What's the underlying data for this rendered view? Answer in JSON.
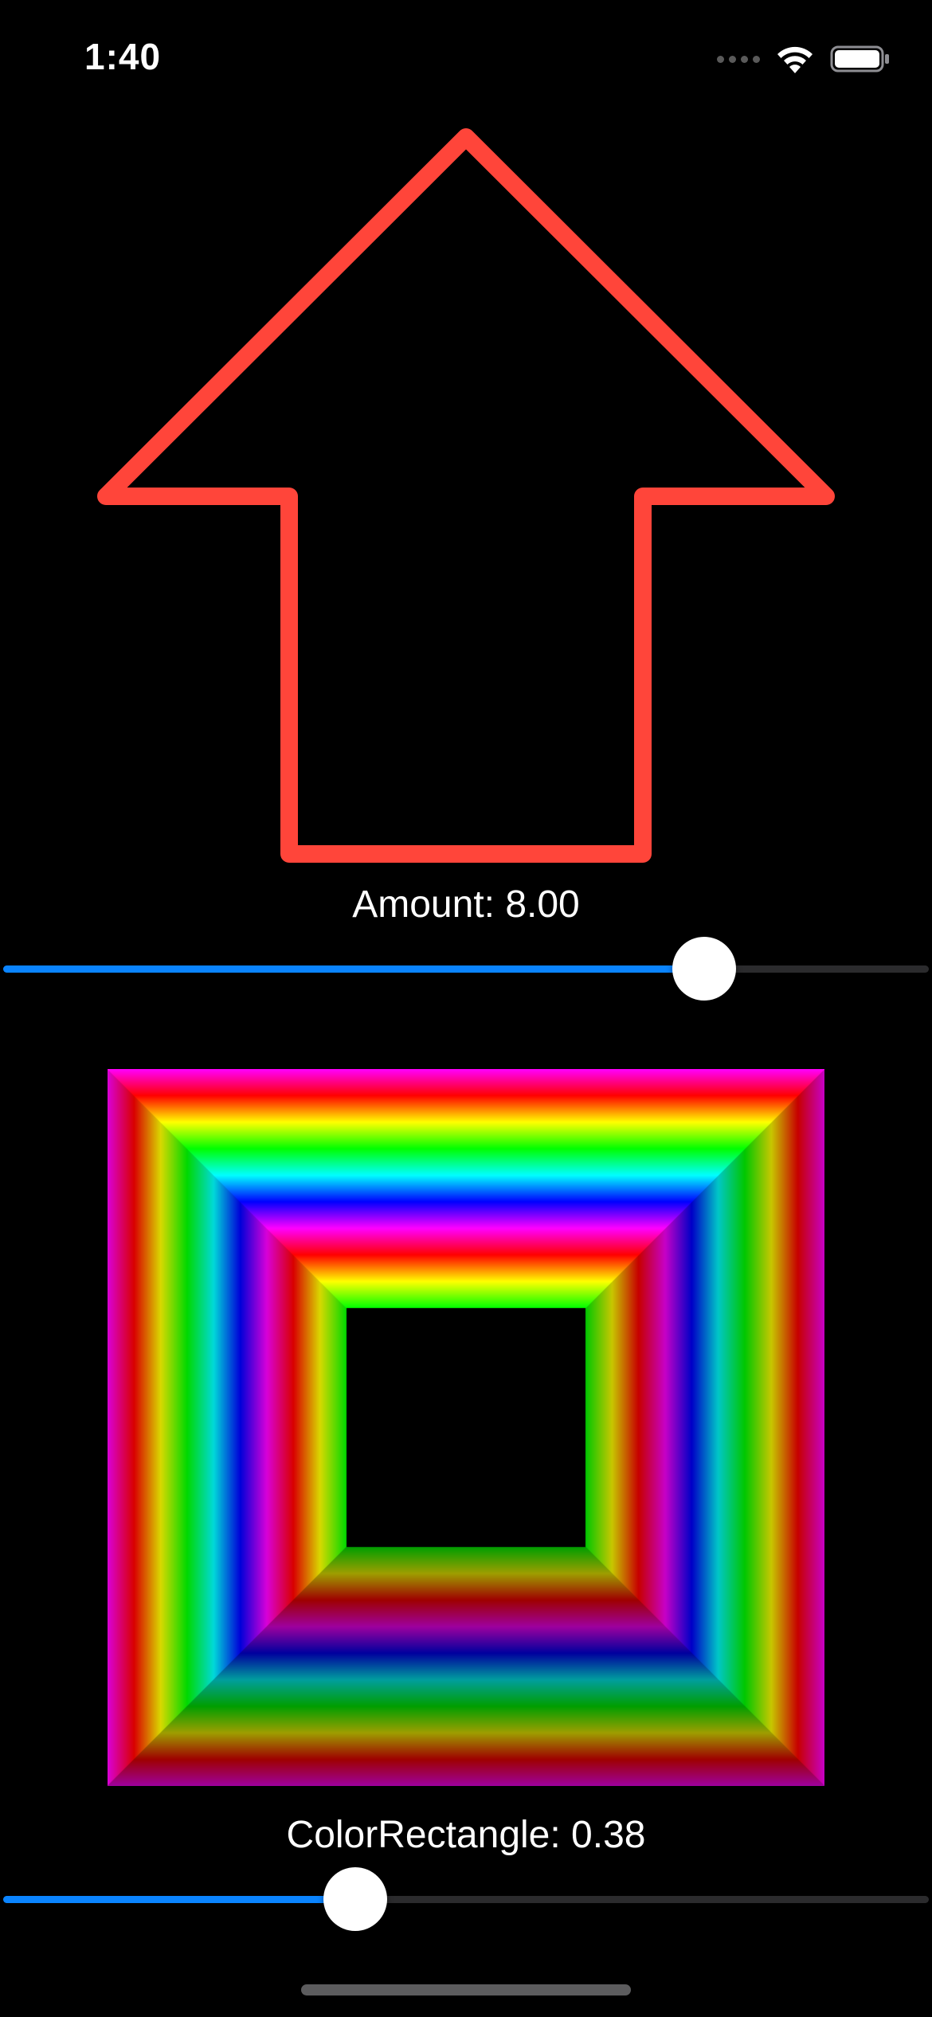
{
  "status_bar": {
    "time": "1:40",
    "icons": [
      "cellular-signal-icon",
      "wifi-icon",
      "battery-icon"
    ]
  },
  "arrow_shape": {
    "stroke_color": "#ff453a"
  },
  "amount": {
    "label": "Amount: 8.00",
    "value": 8.0,
    "slider_fraction": 0.757
  },
  "color_rectangle": {
    "label": "ColorRectangle: 0.38",
    "value": 0.38,
    "slider_fraction": 0.38
  },
  "colors": {
    "accent": "#0a84ff",
    "background": "#000000",
    "track": "#2b2b2d"
  }
}
